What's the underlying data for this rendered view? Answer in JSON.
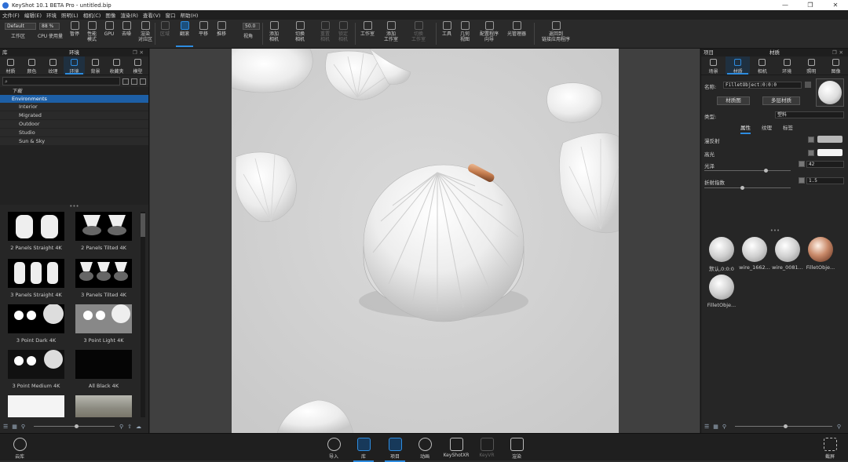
{
  "window": {
    "title": "KeyShot 10.1 BETA Pro  -  untitled.bip",
    "controls": [
      "—",
      "❐",
      "✕"
    ]
  },
  "menu": [
    "文件(F)",
    "编辑(E)",
    "环境",
    "照明(L)",
    "相机(C)",
    "图像",
    "渲染(R)",
    "查看(V)",
    "窗口",
    "帮助(H)"
  ],
  "ribbon": {
    "workspace_value": "Default",
    "cpu_value": "88 %",
    "zoom_value": "50.0",
    "buttons": [
      {
        "id": "workspace",
        "label": "工作区"
      },
      {
        "id": "cpu",
        "label": "CPU 使用量"
      },
      {
        "id": "pause",
        "label": "暂停"
      },
      {
        "id": "perf",
        "label": "性能\n模式"
      },
      {
        "id": "gpu",
        "label": "GPU"
      },
      {
        "id": "denoise",
        "label": "去噪"
      },
      {
        "id": "render-rt",
        "label": "渲染\n对应区"
      },
      {
        "id": "region",
        "label": "区域"
      },
      {
        "id": "tumble",
        "label": "翻滚"
      },
      {
        "id": "pan",
        "label": "平移"
      },
      {
        "id": "dolly",
        "label": "推移"
      },
      {
        "id": "fov",
        "label": "视角"
      },
      {
        "id": "add-camera",
        "label": "添加\n相机"
      },
      {
        "id": "switch-camera",
        "label": "切换\n相机"
      },
      {
        "id": "reset-camera",
        "label": "重置\n相机"
      },
      {
        "id": "lock-camera",
        "label": "锁定\n相机"
      },
      {
        "id": "studio",
        "label": "工作室"
      },
      {
        "id": "add-studio",
        "label": "添加\n工作室"
      },
      {
        "id": "switch-studio",
        "label": "切换\n工作室"
      },
      {
        "id": "tools",
        "label": "工具"
      },
      {
        "id": "geo-view",
        "label": "几何\n视图"
      },
      {
        "id": "config-wizard",
        "label": "配置程序\n向导"
      },
      {
        "id": "light-manager",
        "label": "光管理器"
      },
      {
        "id": "return-link",
        "label": "返回到\n链接应用程序"
      }
    ]
  },
  "left_panel": {
    "header_left": "库",
    "title": "环境",
    "tabs": [
      "材质",
      "颜色",
      "纹理",
      "环境",
      "背景",
      "收藏夹",
      "模型"
    ],
    "search_placeholder": "",
    "tree": {
      "downloads": "下载",
      "root": "Environments",
      "children": [
        "Interior",
        "Migrated",
        "Outdoor",
        "Studio",
        "Sun & Sky"
      ]
    },
    "thumbnails": [
      "2 Panels Straight 4K",
      "2 Panels Tilted 4K",
      "3 Panels Straight 4K",
      "3 Panels Tilted 4K",
      "3 Point Dark 4K",
      "3 Point Light 4K",
      "3 Point Medium 4K",
      "All Black 4K",
      "",
      ""
    ]
  },
  "right_panel": {
    "header_left": "项目",
    "title": "材质",
    "tabs": [
      "场景",
      "材质",
      "相机",
      "环境",
      "照明",
      "图像"
    ],
    "name_label": "名称:",
    "name_value": "FilletObject:0:0:0",
    "material_graph_button": "材质图",
    "multi_material_button": "多层材质",
    "type_label": "类型:",
    "type_value": "塑料",
    "subtabs": [
      "属性",
      "纹理",
      "标签"
    ],
    "properties": [
      {
        "label": "漫反射",
        "color": "#b8b8b8"
      },
      {
        "label": "高光",
        "color": "#f4f4f4"
      },
      {
        "label": "光泽",
        "value": "42"
      },
      {
        "label": "折射指数",
        "value": "1.5"
      }
    ],
    "materials": [
      "默认,0:0:0",
      "wire_1662...",
      "wire_0081...",
      "FilletObje...",
      "FilletObje..."
    ]
  },
  "footer": {
    "cloud": "云库",
    "buttons": [
      "导入",
      "库",
      "项目",
      "动画",
      "KeyShotXR",
      "KeyVR",
      "渲染"
    ],
    "screenshot": "截屏"
  },
  "colors": {
    "accent": "#2d8ce0",
    "selection": "#1d5fa6"
  }
}
